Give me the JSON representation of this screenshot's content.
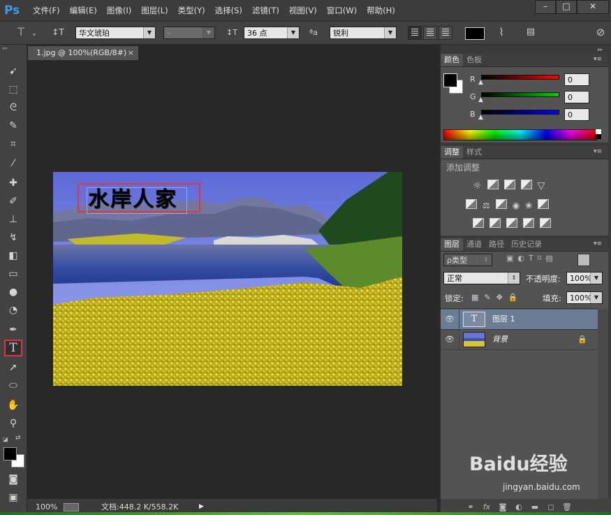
{
  "app": {
    "logo": "Ps"
  },
  "menu": [
    "文件(F)",
    "编辑(E)",
    "图像(I)",
    "图层(L)",
    "类型(Y)",
    "选择(S)",
    "滤镜(T)",
    "视图(V)",
    "窗口(W)",
    "帮助(H)"
  ],
  "window_controls": {
    "minimize": "–",
    "maximize": "□",
    "close": "✕"
  },
  "options": {
    "tool_glyph": "T",
    "orientation_glyph": "↕T",
    "font_family": "华文琥珀",
    "font_style": "-",
    "size_icon": "↕T",
    "font_size": "36 点",
    "aa_icon": "ªa",
    "antialias": "锐利"
  },
  "document": {
    "tab_title": "1.jpg @ 100%(RGB/8#)",
    "tab_close": "×",
    "text_layer_content": "水岸人家"
  },
  "status": {
    "zoom": "100%",
    "doc_info": "文档:448.2 K/558.2K"
  },
  "color_panel": {
    "tabs": [
      "颜色",
      "色板"
    ],
    "channels": [
      {
        "label": "R",
        "value": "0",
        "color": "#ff0000"
      },
      {
        "label": "G",
        "value": "0",
        "color": "#00d000"
      },
      {
        "label": "B",
        "value": "0",
        "color": "#0000ff"
      }
    ]
  },
  "adjust_panel": {
    "tabs": [
      "调整",
      "样式"
    ],
    "heading": "添加调整"
  },
  "layers_panel": {
    "tabs": [
      "图层",
      "通道",
      "路径",
      "历史记录"
    ],
    "filter": "ρ类型",
    "blend_mode": "正常",
    "opacity_label": "不透明度:",
    "opacity": "100%",
    "lock_label": "锁定:",
    "fill_label": "填充:",
    "fill": "100%",
    "layers": [
      {
        "name": "图层 1",
        "thumb": "T",
        "selected": true
      },
      {
        "name": "背景",
        "locked": true,
        "lock_icon": "🔒"
      }
    ],
    "bottom_icons": [
      "fx"
    ]
  },
  "watermark": {
    "brand": "Baidu经验",
    "url": "jingyan.baidu.com"
  },
  "colors": {
    "accent": "#3d9be9",
    "highlight_box": "#e0353a",
    "panel_bg": "#535353",
    "canvas_bg": "#282828"
  }
}
